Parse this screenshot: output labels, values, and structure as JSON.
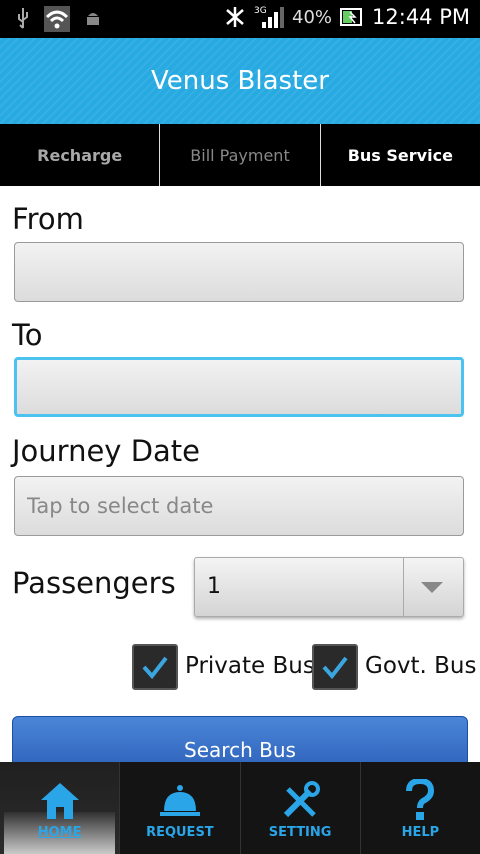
{
  "status_bar": {
    "time": "12:44 PM",
    "battery_percent": "40%",
    "network": "3G",
    "icons": [
      "usb-icon",
      "wifi-icon",
      "android-icon",
      "bluetooth-icon",
      "signal-icon",
      "battery-icon"
    ]
  },
  "app": {
    "title": "Venus Blaster"
  },
  "tabs": [
    {
      "label": "Recharge"
    },
    {
      "label": "Bill Payment"
    },
    {
      "label": "Bus Service"
    }
  ],
  "form": {
    "from_label": "From",
    "from_value": "",
    "to_label": "To",
    "to_value": "",
    "date_label": "Journey Date",
    "date_placeholder": "Tap to select date",
    "passengers_label": "Passengers",
    "passengers_value": "1",
    "private_bus_label": "Private Bus",
    "private_bus_checked": true,
    "govt_bus_label": "Govt. Bus",
    "govt_bus_checked": true,
    "search_button_label": "Search Bus"
  },
  "bottom_nav": [
    {
      "label": "HOME",
      "icon": "home-icon"
    },
    {
      "label": "REQUEST",
      "icon": "service-bell-icon"
    },
    {
      "label": "SETTING",
      "icon": "tools-icon"
    },
    {
      "label": "HELP",
      "icon": "question-icon"
    }
  ],
  "colors": {
    "accent": "#27a9e1",
    "focus": "#4cc2ef",
    "button": "#2c5fb8",
    "nav_label": "#2aa5e8"
  }
}
